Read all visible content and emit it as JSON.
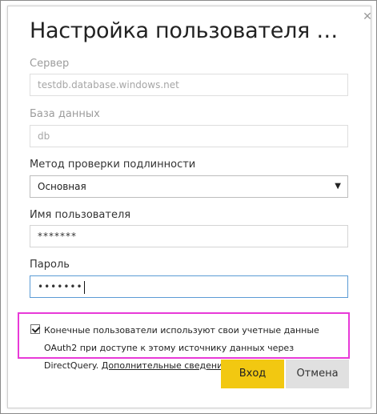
{
  "dialog": {
    "title": "Настройка пользователя SQL...",
    "close_glyph": "✕"
  },
  "server": {
    "label": "Сервер",
    "value": "testdb.database.windows.net"
  },
  "database": {
    "label": "База данных",
    "value": "db"
  },
  "auth": {
    "label": "Метод проверки подлинности",
    "selected": "Основная",
    "arrow_glyph": "▼"
  },
  "username": {
    "label": "Имя пользователя",
    "value": "*******"
  },
  "password": {
    "label": "Пароль",
    "value": "•••••••"
  },
  "consent": {
    "checked": true,
    "text": "Конечные пользователи используют свои учетные данные OAuth2 при доступе к этому источнику данных через DirectQuery.",
    "link": "Дополнительные сведения"
  },
  "buttons": {
    "primary": "Вход",
    "secondary": "Отмена"
  },
  "colors": {
    "accent": "#f2c811",
    "highlight": "#e83ad8",
    "focus_border": "#5b9bd5"
  }
}
